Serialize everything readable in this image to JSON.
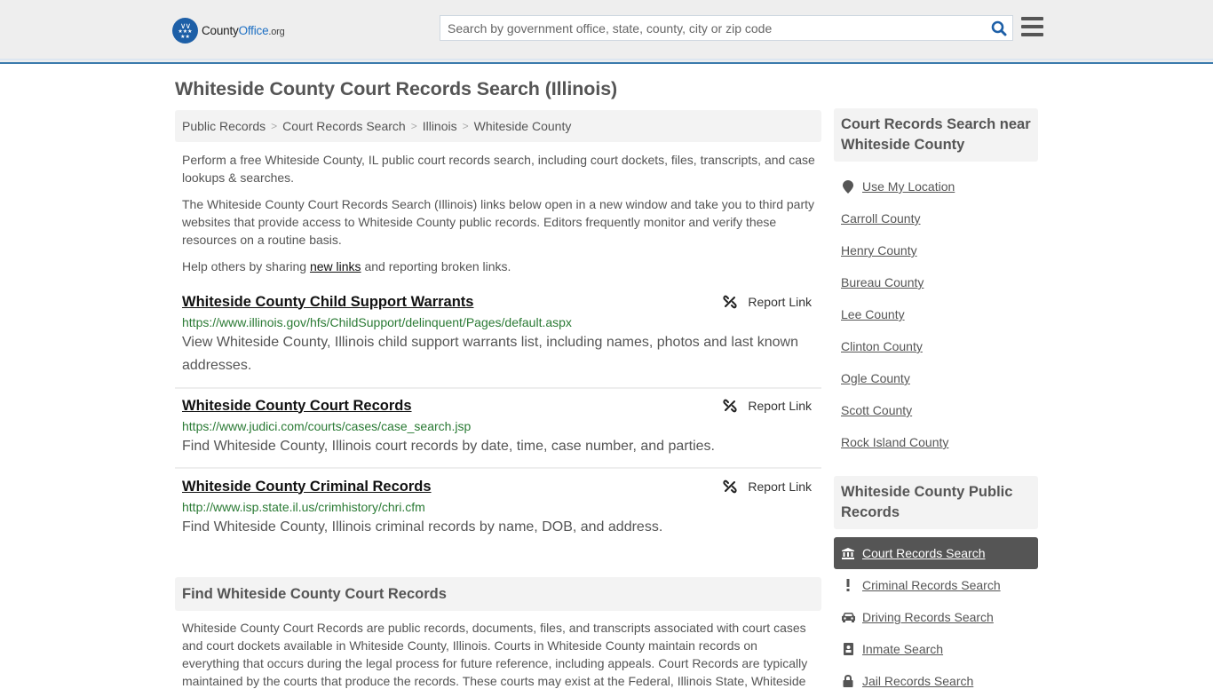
{
  "header": {
    "logo": {
      "county": "County",
      "office": "Office",
      "org": ".org"
    },
    "search_placeholder": "Search by government office, state, county, city or zip code",
    "search_value": "",
    "colors": {
      "accent": "#3a7aac",
      "brand": "#1d5fa7",
      "search_icon": "#1d5fa7"
    }
  },
  "page": {
    "title": "Whiteside County Court Records Search (Illinois)"
  },
  "breadcrumb": [
    {
      "label": "Public Records"
    },
    {
      "label": "Court Records Search"
    },
    {
      "label": "Illinois"
    },
    {
      "label": "Whiteside County"
    }
  ],
  "breadcrumb_separator": ">",
  "intro": {
    "p1": "Perform a free Whiteside County, IL public court records search, including court dockets, files, transcripts, and case lookups & searches.",
    "p2": "The Whiteside County Court Records Search (Illinois) links below open in a new window and take you to third party websites that provide access to Whiteside County public records. Editors frequently monitor and verify these resources on a routine basis.",
    "p3_before": "Help others by sharing ",
    "p3_link": "new links",
    "p3_after": " and reporting broken links."
  },
  "listings": [
    {
      "title": "Whiteside County Child Support Warrants",
      "url": "https://www.illinois.gov/hfs/ChildSupport/delinquent/Pages/default.aspx",
      "description": "View Whiteside County, Illinois child support warrants list, including names, photos and last known addresses.",
      "report_label": "Report Link"
    },
    {
      "title": "Whiteside County Court Records",
      "url": "https://www.judici.com/courts/cases/case_search.jsp",
      "description": "Find Whiteside County, Illinois court records by date, time, case number, and parties.",
      "report_label": "Report Link"
    },
    {
      "title": "Whiteside County Criminal Records",
      "url": "http://www.isp.state.il.us/crimhistory/chri.cfm",
      "description": "Find Whiteside County, Illinois criminal records by name, DOB, and address.",
      "report_label": "Report Link"
    }
  ],
  "find_section": {
    "heading": "Find Whiteside County Court Records",
    "body": "Whiteside County Court Records are public records, documents, files, and transcripts associated with court cases and court dockets available in Whiteside County, Illinois. Courts in Whiteside County maintain records on everything that occurs during the legal process for future reference, including appeals. Court Records are typically maintained by the courts that produce the records. These courts may exist at the Federal, Illinois State, Whiteside"
  },
  "sidebar": {
    "nearby_heading": "Court Records Search near Whiteside County",
    "use_location": {
      "label": "Use My Location",
      "icon": "map-marker-icon"
    },
    "nearby": [
      "Carroll County",
      "Henry County",
      "Bureau County",
      "Lee County",
      "Clinton County",
      "Ogle County",
      "Scott County",
      "Rock Island County"
    ],
    "public_records_heading": "Whiteside County Public Records",
    "public_records": [
      {
        "label": "Court Records Search",
        "icon": "courthouse-icon",
        "active": true
      },
      {
        "label": "Criminal Records Search",
        "icon": "exclamation-icon",
        "active": false
      },
      {
        "label": "Driving Records Search",
        "icon": "car-icon",
        "active": false
      },
      {
        "label": "Inmate Search",
        "icon": "id-badge-icon",
        "active": false
      },
      {
        "label": "Jail Records Search",
        "icon": "lock-icon",
        "active": false
      }
    ]
  }
}
